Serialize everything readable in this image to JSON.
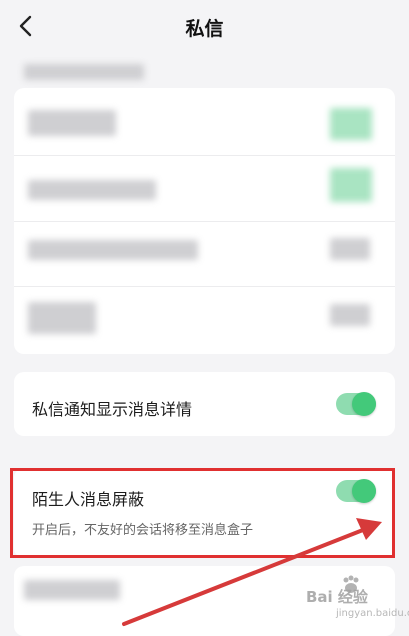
{
  "header": {
    "title": "私信",
    "back_icon": "chevron-left-icon"
  },
  "settings": {
    "show_detail": {
      "label": "私信通知显示消息详情",
      "enabled": true
    },
    "stranger_block": {
      "label": "陌生人消息屏蔽",
      "description": "开启后，不友好的会话将移至消息盒子",
      "enabled": true
    }
  },
  "colors": {
    "toggle_on": "#43c97a",
    "toggle_track": "#8fdcb0",
    "highlight": "#e03030",
    "arrow": "#d63a3a"
  },
  "watermark": {
    "text": "Bai 经验",
    "sub": "jingyan.baidu.com"
  }
}
